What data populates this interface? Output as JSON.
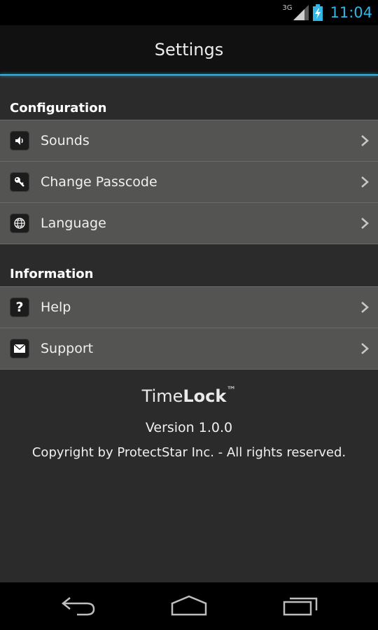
{
  "status_bar": {
    "network": "3G",
    "time": "11:04",
    "accent_color": "#33b5e5"
  },
  "action_bar": {
    "title": "Settings"
  },
  "sections": [
    {
      "header": "Configuration",
      "items": [
        {
          "label": "Sounds",
          "icon": "speaker-icon"
        },
        {
          "label": "Change Passcode",
          "icon": "key-icon"
        },
        {
          "label": "Language",
          "icon": "globe-icon"
        }
      ]
    },
    {
      "header": "Information",
      "items": [
        {
          "label": "Help",
          "icon": "question-icon"
        },
        {
          "label": "Support",
          "icon": "envelope-icon"
        }
      ]
    }
  ],
  "about": {
    "app_name_light": "Time",
    "app_name_bold": "Lock",
    "trademark": "™",
    "version": "Version 1.0.0",
    "copyright": "Copyright by ProtectStar Inc. - All rights reserved."
  },
  "nav_bar": {
    "buttons": [
      "back-icon",
      "home-icon",
      "recent-apps-icon"
    ]
  }
}
